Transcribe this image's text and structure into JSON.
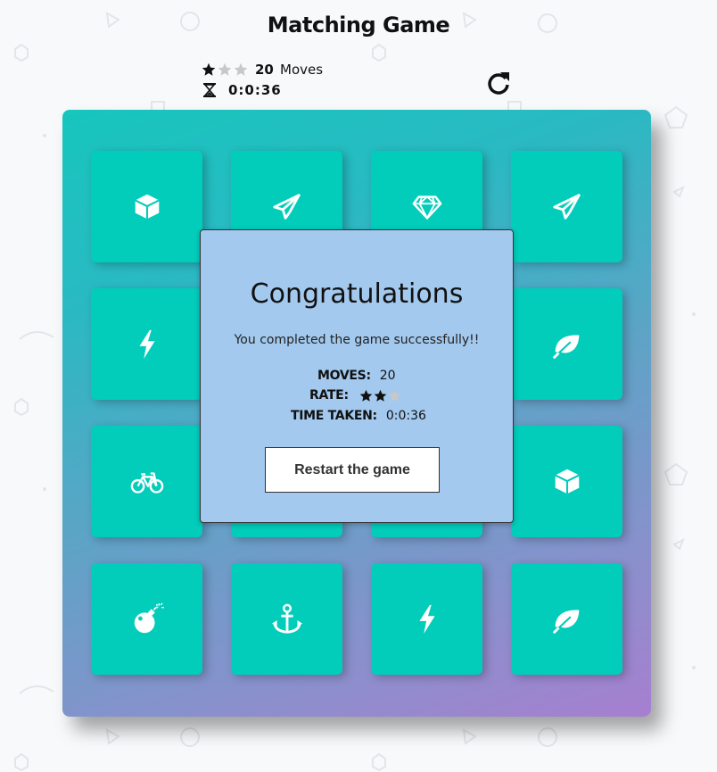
{
  "game": {
    "title": "Matching Game",
    "stars_filled": 1,
    "stars_total": 3,
    "moves": "20",
    "moves_label": "Moves",
    "timer": "0:0:36"
  },
  "icons": {
    "star": "star-icon",
    "timer": "hourglass-icon",
    "restart": "repeat-icon"
  },
  "colors": {
    "card": "#02ccba",
    "deck_gradient_start": "#17c6bd",
    "deck_gradient_end": "#a77fd0",
    "modal_bg": "#a3c9ee",
    "star_filled": "#111111",
    "star_empty": "#c8c8c8"
  },
  "cards": [
    {
      "icon": "cube-icon"
    },
    {
      "icon": "paper-plane-icon"
    },
    {
      "icon": "diamond-icon"
    },
    {
      "icon": "paper-plane-icon"
    },
    {
      "icon": "bolt-icon"
    },
    {
      "icon": "hidden"
    },
    {
      "icon": "hidden"
    },
    {
      "icon": "leaf-icon"
    },
    {
      "icon": "bicycle-icon"
    },
    {
      "icon": "hidden"
    },
    {
      "icon": "hidden"
    },
    {
      "icon": "cube-icon"
    },
    {
      "icon": "bomb-icon"
    },
    {
      "icon": "anchor-icon"
    },
    {
      "icon": "bolt-icon"
    },
    {
      "icon": "leaf-icon"
    }
  ],
  "modal": {
    "heading": "Congratulations",
    "text": "You completed the game successfully!!",
    "moves_label": "MOVES:",
    "moves_value": "20",
    "rate_label": "RATE:",
    "rate_stars_filled": 2,
    "rate_stars_total": 3,
    "time_label": "TIME TAKEN:",
    "time_value": "0:0:36",
    "restart_button": "Restart the game"
  }
}
